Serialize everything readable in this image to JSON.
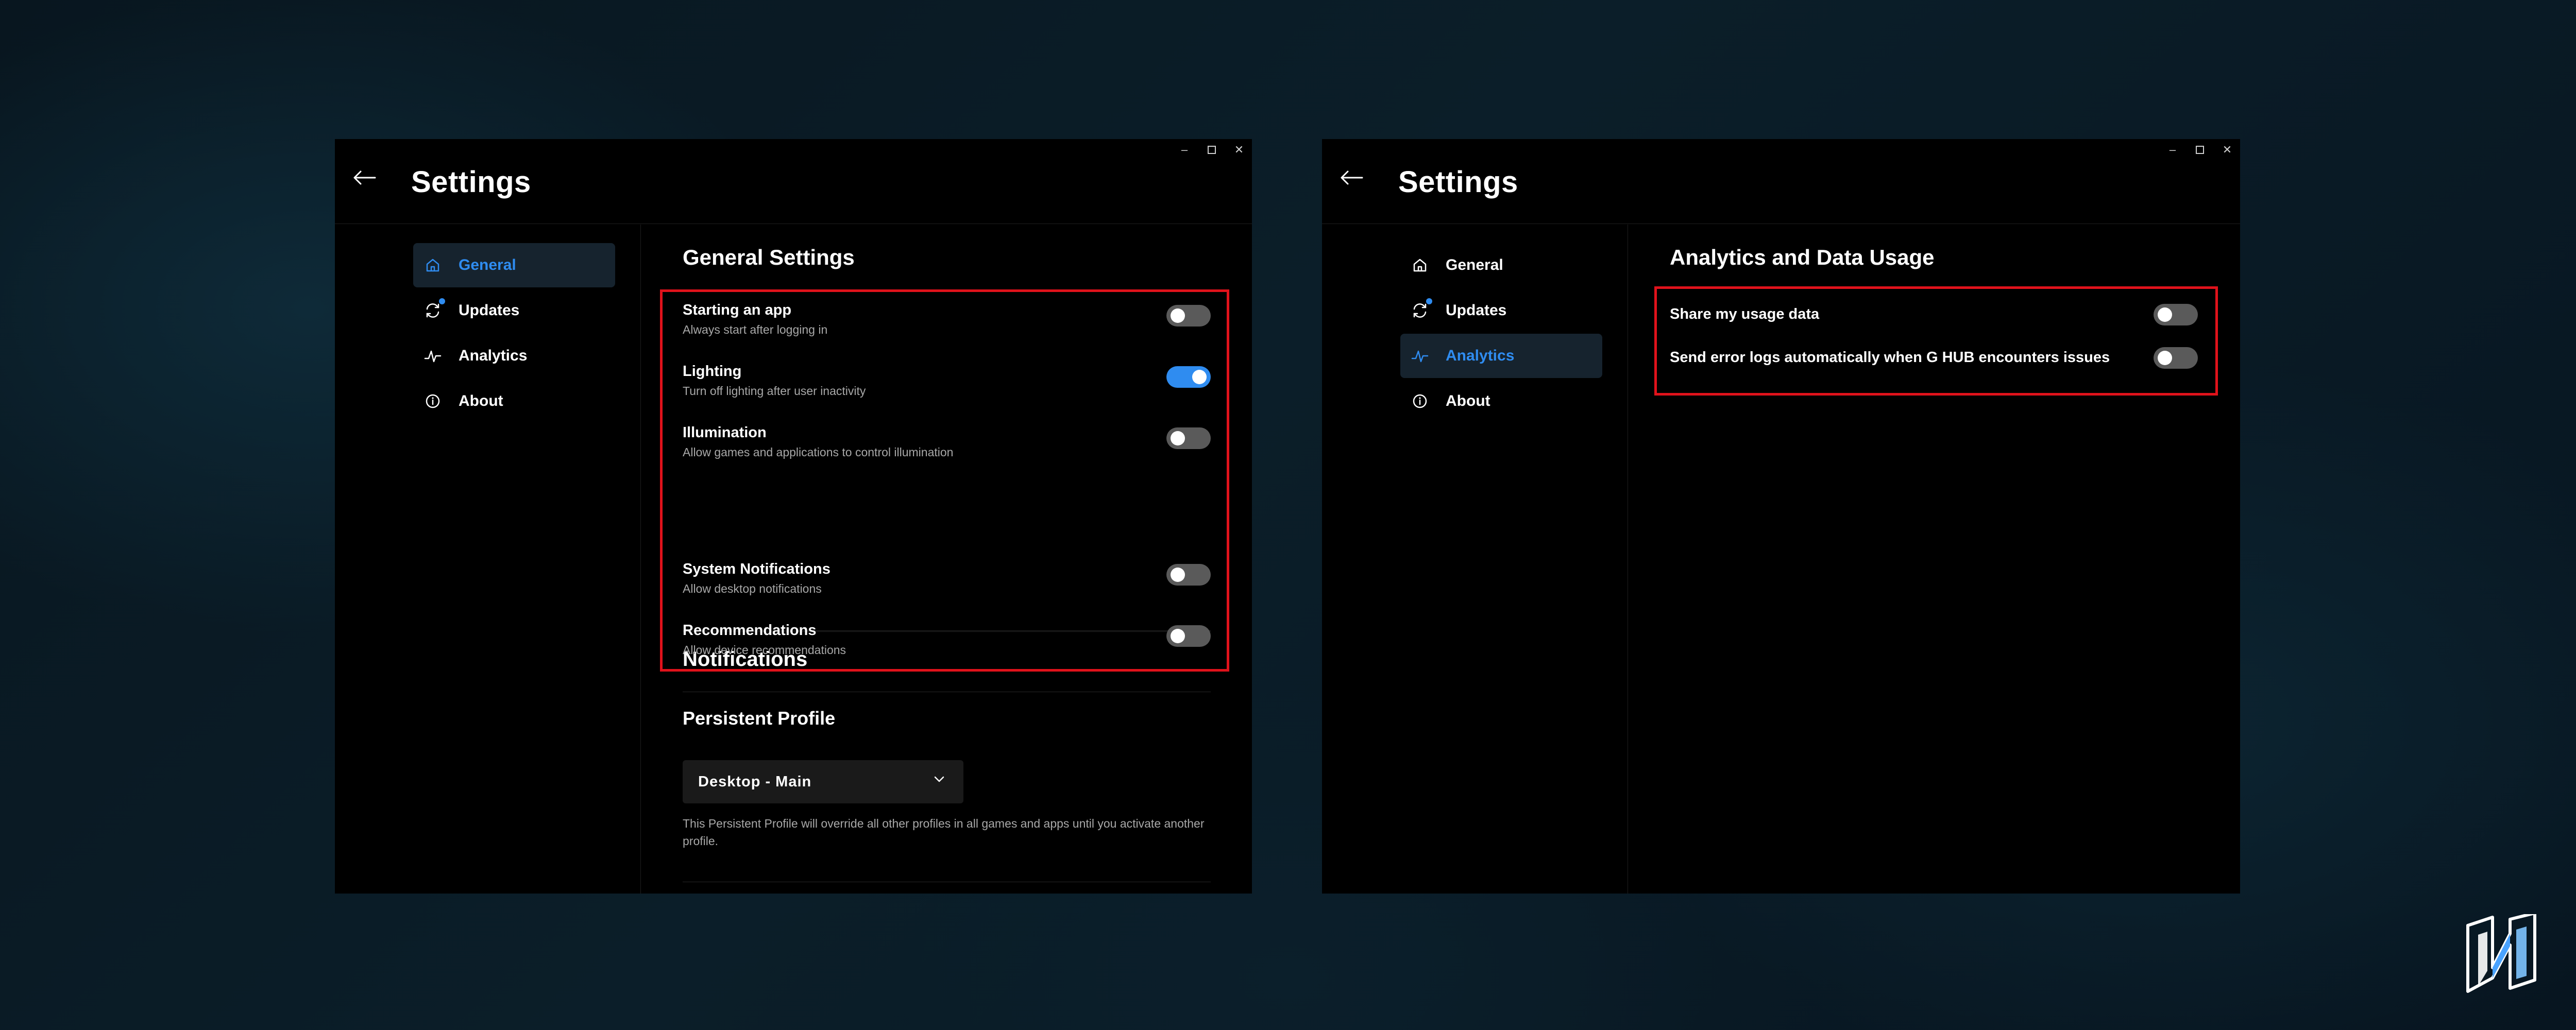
{
  "windows": {
    "general": {
      "title": "Settings",
      "sidebar": {
        "items": [
          {
            "label": "General",
            "icon": "home-icon",
            "active": true
          },
          {
            "label": "Updates",
            "icon": "refresh-icon",
            "badge": true
          },
          {
            "label": "Analytics",
            "icon": "pulse-icon"
          },
          {
            "label": "About",
            "icon": "info-icon"
          }
        ]
      },
      "general_settings": {
        "title": "General Settings",
        "rows": [
          {
            "label": "Starting an app",
            "desc": "Always start after logging in",
            "on": false
          },
          {
            "label": "Lighting",
            "desc": "Turn off lighting after user inactivity",
            "on": true
          },
          {
            "label": "Illumination",
            "desc": "Allow games and applications to control illumination",
            "on": false
          }
        ]
      },
      "notifications": {
        "title": "Notifications",
        "rows": [
          {
            "label": "System Notifications",
            "desc": "Allow desktop notifications",
            "on": false
          },
          {
            "label": "Recommendations",
            "desc": "Allow device recommendations",
            "on": false
          }
        ]
      },
      "persistent_profile": {
        "title": "Persistent Profile",
        "selected": "Desktop - Main",
        "note": "This Persistent Profile will override all other profiles in all games and apps until you activate another profile."
      }
    },
    "analytics": {
      "title": "Settings",
      "sidebar": {
        "items": [
          {
            "label": "General",
            "icon": "home-icon"
          },
          {
            "label": "Updates",
            "icon": "refresh-icon",
            "badge": true
          },
          {
            "label": "Analytics",
            "icon": "pulse-icon",
            "active": true
          },
          {
            "label": "About",
            "icon": "info-icon"
          }
        ]
      },
      "analytics_section": {
        "title": "Analytics and Data Usage",
        "rows": [
          {
            "label": "Share my usage data",
            "on": false
          },
          {
            "label": "Send error logs automatically when G HUB encounters issues",
            "on": false
          }
        ]
      }
    }
  },
  "colors": {
    "accent": "#2f8cf0",
    "highlight": "#e0121b",
    "toggle_off": "#5a5a5a",
    "active_nav_bg": "#16232e"
  },
  "logo": {
    "icon": "n-logo-icon"
  }
}
